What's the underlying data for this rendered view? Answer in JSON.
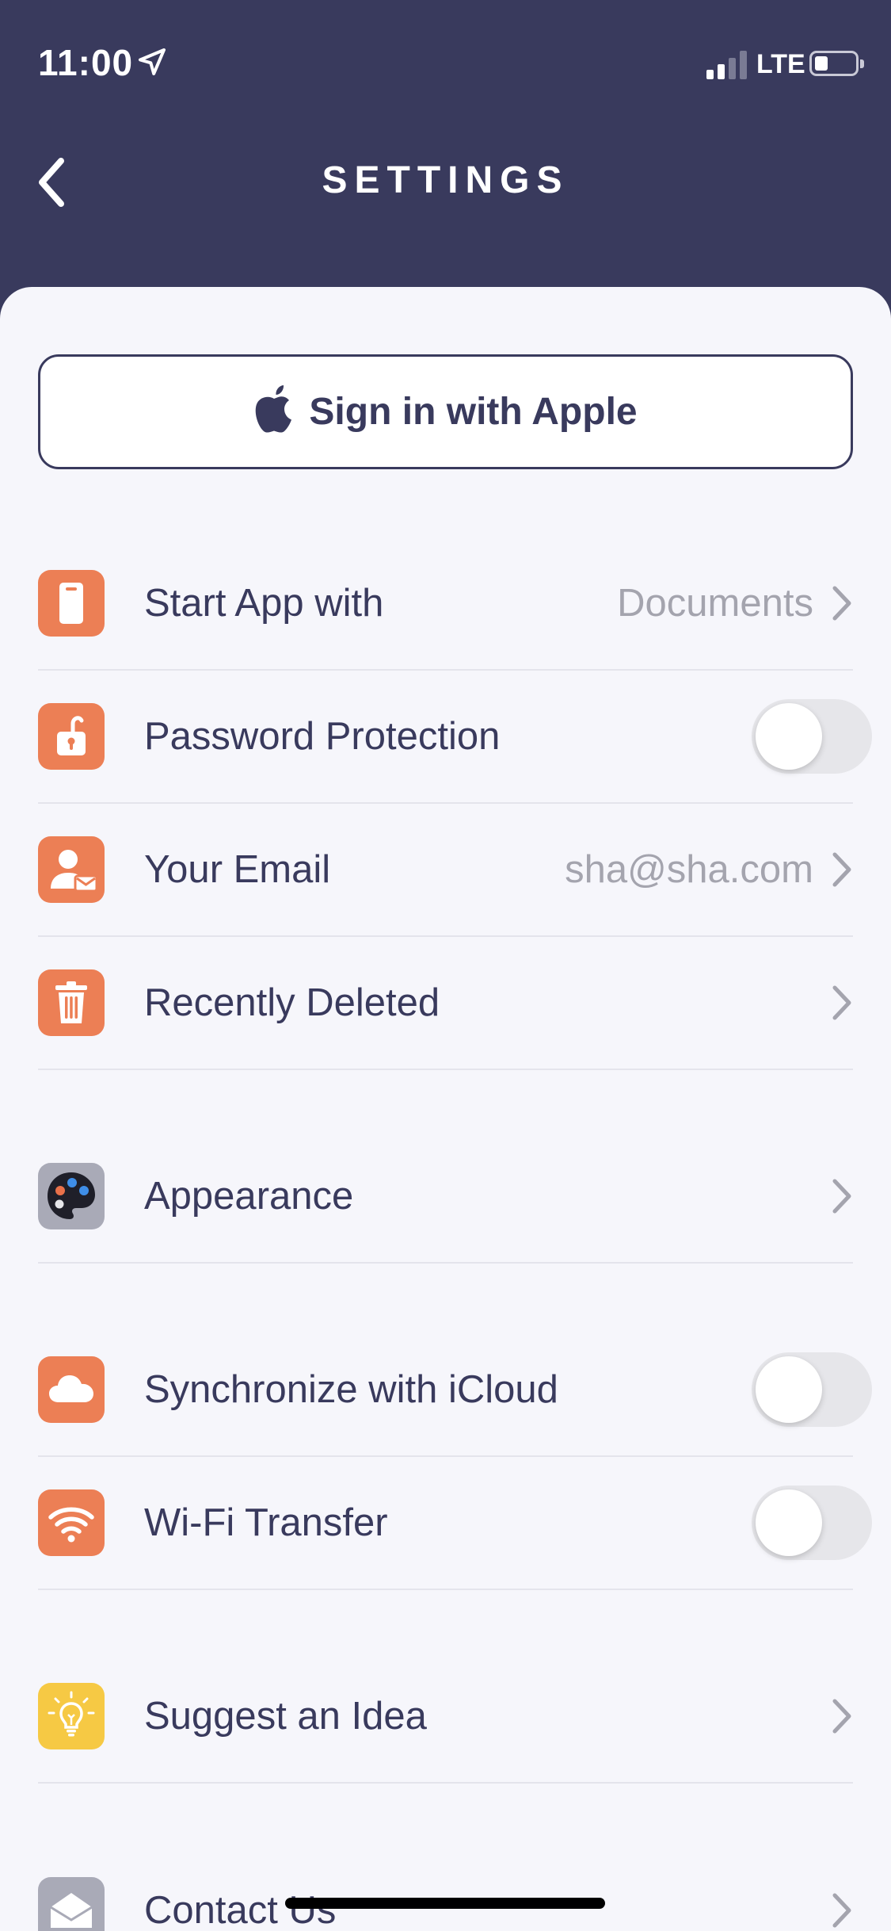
{
  "status_bar": {
    "time": "11:00",
    "network": "LTE",
    "signal_bars_active": 2,
    "signal_bars_total": 4,
    "battery_level": 0.25
  },
  "nav": {
    "title": "SETTINGS",
    "back_icon": "chevron-left-icon"
  },
  "sign_in": {
    "label": "Sign in with Apple",
    "icon": "apple-logo-icon"
  },
  "colors": {
    "header_bg": "#393a5d",
    "sheet_bg": "#f6f6fb",
    "accent_orange": "#ec7f55",
    "accent_yellow": "#f6c944",
    "text_primary": "#393a5d",
    "text_secondary": "#a4a4ae"
  },
  "settings": [
    {
      "label": "Start App with",
      "value": "Documents",
      "icon": "phone-icon",
      "control": "chevron"
    },
    {
      "label": "Password Protection",
      "icon": "unlock-icon",
      "control": "toggle",
      "enabled": false
    },
    {
      "label": "Your Email",
      "value": "sha@sha.com",
      "icon": "user-mail-icon",
      "control": "chevron"
    },
    {
      "label": "Recently Deleted",
      "icon": "trash-icon",
      "control": "chevron"
    },
    {
      "label": "Appearance",
      "icon": "palette-icon",
      "control": "chevron"
    },
    {
      "label": "Synchronize with iCloud",
      "icon": "cloud-icon",
      "control": "toggle",
      "enabled": false
    },
    {
      "label": "Wi-Fi Transfer",
      "icon": "wifi-icon",
      "control": "toggle",
      "enabled": false
    },
    {
      "label": "Suggest an Idea",
      "icon": "lightbulb-icon",
      "control": "chevron"
    },
    {
      "label": "Contact Us",
      "icon": "envelope-icon",
      "control": "chevron"
    }
  ]
}
